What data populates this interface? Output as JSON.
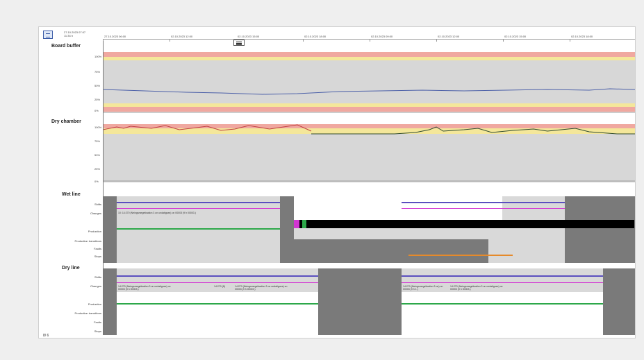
{
  "header": {
    "start_datetime_line1": "27.10.2023 07:07",
    "start_datetime_line2": "11:34 h",
    "time_labels": [
      "27.10.2023 06:00",
      "02.10.2023 12:00",
      "02.10.2023 15:00",
      "02.10.2023 18:00",
      "02.10.2023 09:00",
      "02.10.2023 12:00",
      "02.10.2023 15:00",
      "02.10.2023 18:00"
    ]
  },
  "panels": {
    "board_buffer": {
      "title": "Board buffer",
      "y_labels": [
        "100%",
        "75%",
        "50%",
        "25%",
        "0%"
      ]
    },
    "dry_chamber": {
      "title": "Dry chamber",
      "y_labels": [
        "100%",
        "75%",
        "50%",
        "25%",
        "0%"
      ]
    },
    "wet_line": {
      "title": "Wet line",
      "rows": [
        "Shifts",
        "Changes",
        "Production",
        "Production transitions",
        "Faults",
        "Stops"
      ],
      "events": [
        "10: 14:270 (Neingsmegetisation 3 on undatigues) on 00003 (9 h 00003.)"
      ]
    },
    "dry_line": {
      "title": "Dry line",
      "rows": [
        "Shifts",
        "Changes",
        "Production",
        "Production transitions",
        "Faults",
        "Stops"
      ],
      "events": [
        "14:270 (Neingsmegetisation 3 on undatigues) on 00003 (9 h 00003.)",
        "14:270 (8)",
        "14:270 (Neingsmegetisation 3 on undatigues) on 00003 (9 h 00003.)",
        "14:270 (Neingsmegetisation 3 on) on 00003 (9 h 1.)",
        "14:270 (Neingsmegetisation 3 on undatigues) on 00003 (9 h 00003.)"
      ]
    }
  },
  "footer": {
    "corner_label": "8/ 6"
  },
  "colors": {
    "red_band": "#f0a8a0",
    "yellow_band": "#f4e79a",
    "gray_band": "#d7d7d7",
    "line_blue": "#4b5fa8",
    "shift_purple": "#5b4fbf",
    "magenta": "#d235d2",
    "green": "#2da84a",
    "orange": "#e58a2b",
    "dark_gray": "#787878"
  }
}
